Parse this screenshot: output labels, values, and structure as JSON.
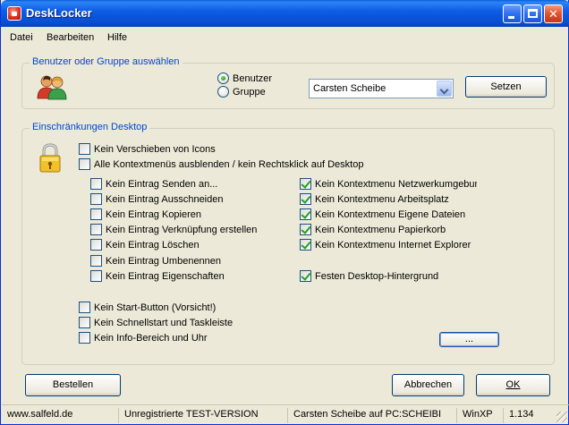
{
  "window": {
    "title": "DeskLocker",
    "controls": {
      "minimize": "_",
      "maximize": "□",
      "close": "✕"
    }
  },
  "menu": [
    "Datei",
    "Bearbeiten",
    "Hilfe"
  ],
  "user_group": {
    "legend": "Benutzer oder Gruppe auswählen",
    "radio_user": "Benutzer",
    "radio_group": "Gruppe",
    "selected": "Benutzer",
    "combo_value": "Carsten Scheibe",
    "set_button": "Setzen"
  },
  "desktop": {
    "legend": "Einschränkungen Desktop",
    "top_options": [
      {
        "label": "Kein Verschieben von Icons",
        "checked": false
      },
      {
        "label": "Alle Kontextmenüs ausblenden / kein Rechtsklick auf Desktop",
        "checked": false
      }
    ],
    "left_options": [
      {
        "label": "Kein Eintrag Senden an...",
        "checked": false
      },
      {
        "label": "Kein Eintrag Ausschneiden",
        "checked": false
      },
      {
        "label": "Kein Eintrag Kopieren",
        "checked": false
      },
      {
        "label": "Kein Eintrag Verknüpfung erstellen",
        "checked": false
      },
      {
        "label": "Kein Eintrag Löschen",
        "checked": false
      },
      {
        "label": "Kein Eintrag Umbenennen",
        "checked": false
      },
      {
        "label": "Kein Eintrag Eigenschaften",
        "checked": false
      }
    ],
    "right_options": [
      {
        "label": "Kein Kontextmenu Netzwerkumgebung",
        "checked": true
      },
      {
        "label": "Kein Kontextmenu Arbeitsplatz",
        "checked": true
      },
      {
        "label": "Kein Kontextmenu Eigene Dateien",
        "checked": true
      },
      {
        "label": "Kein Kontextmenu Papierkorb",
        "checked": true
      },
      {
        "label": "Kein Kontextmenu Internet Explorer",
        "checked": true
      }
    ],
    "background_option": {
      "label": "Festen Desktop-Hintergrund",
      "checked": true
    },
    "bottom_options": [
      {
        "label": "Kein Start-Button (Vorsicht!)",
        "checked": false
      },
      {
        "label": "Kein Schnellstart und Taskleiste",
        "checked": false
      },
      {
        "label": "Kein Info-Bereich und Uhr",
        "checked": false
      }
    ],
    "dots_button": "..."
  },
  "footer": {
    "order_button": "Bestellen",
    "cancel_button": "Abbrechen",
    "ok_button": "OK"
  },
  "statusbar": [
    "www.salfeld.de",
    "Unregistrierte TEST-VERSION",
    "Carsten Scheibe auf PC:SCHEIBI",
    "WinXP",
    "1.134"
  ],
  "colors": {
    "accent": "#0046d5",
    "titlebar": "#0b55dc",
    "check": "#21a121"
  }
}
